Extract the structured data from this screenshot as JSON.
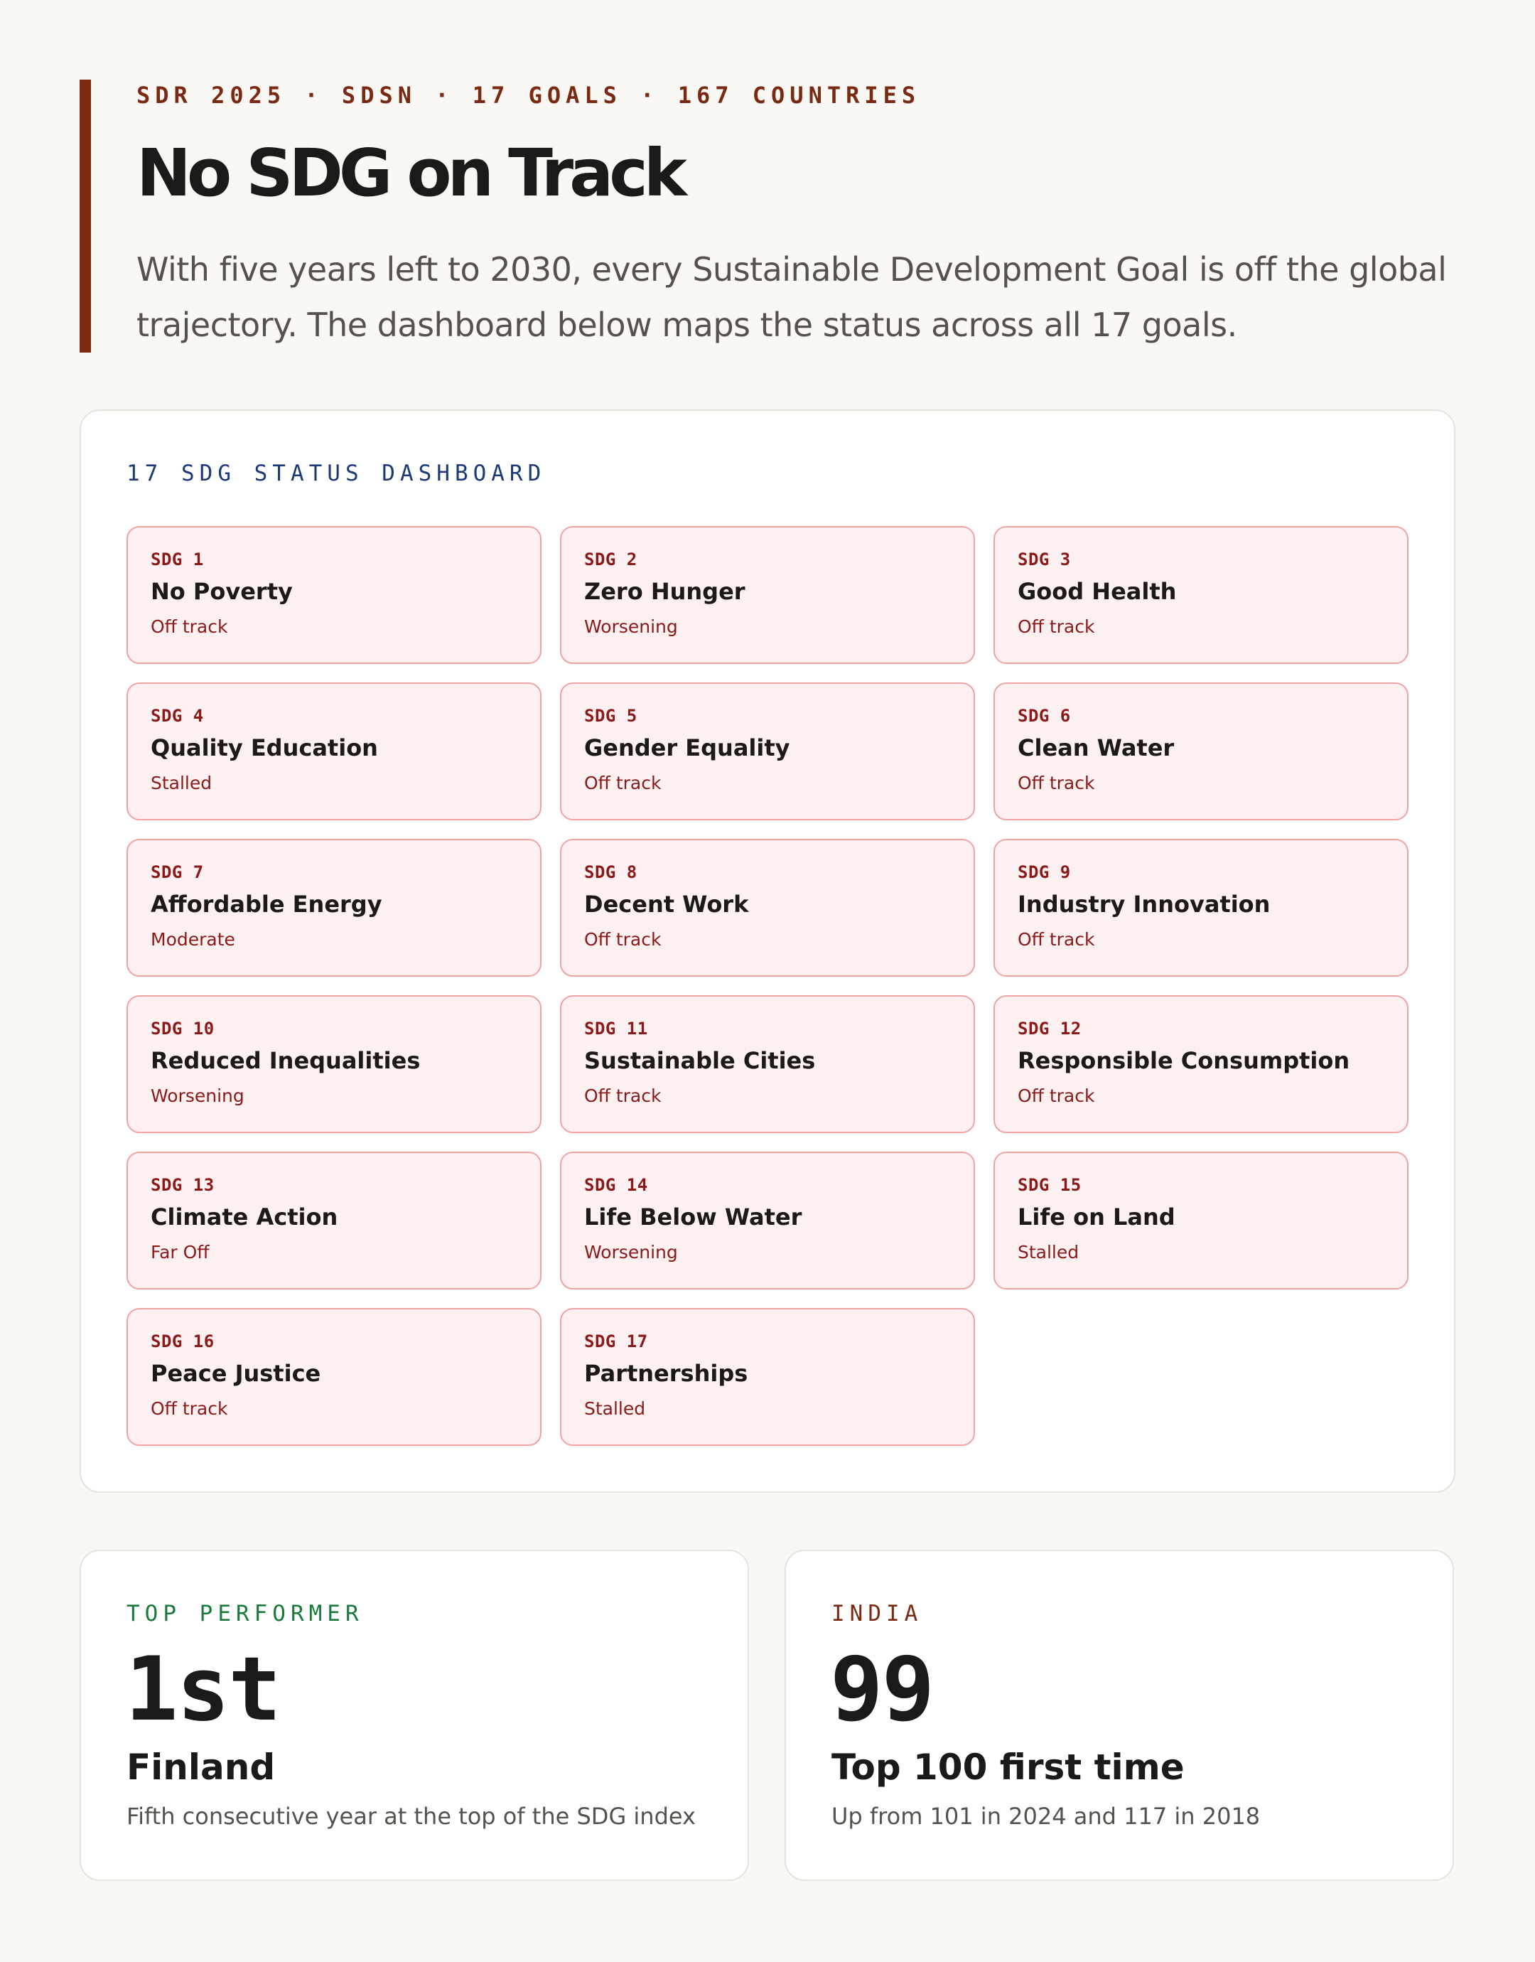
{
  "header": {
    "eyebrow": "SDR 2025 · SDSN · 17 GOALS · 167 COUNTRIES",
    "title": "No SDG on Track",
    "subtitle_line1": "With five years left to 2030, every Sustainable Development Goal is off the global",
    "subtitle_line2": "trajectory. The dashboard below maps the status across all 17 goals."
  },
  "dashboard": {
    "title": "17 SDG STATUS DASHBOARD",
    "goals": [
      {
        "code": "SDG 1",
        "name": "No Poverty",
        "status": "Off track"
      },
      {
        "code": "SDG 2",
        "name": "Zero Hunger",
        "status": "Worsening"
      },
      {
        "code": "SDG 3",
        "name": "Good Health",
        "status": "Off track"
      },
      {
        "code": "SDG 4",
        "name": "Quality Education",
        "status": "Stalled"
      },
      {
        "code": "SDG 5",
        "name": "Gender Equality",
        "status": "Off track"
      },
      {
        "code": "SDG 6",
        "name": "Clean Water",
        "status": "Off track"
      },
      {
        "code": "SDG 7",
        "name": "Affordable Energy",
        "status": "Moderate"
      },
      {
        "code": "SDG 8",
        "name": "Decent Work",
        "status": "Off track"
      },
      {
        "code": "SDG 9",
        "name": "Industry Innovation",
        "status": "Off track"
      },
      {
        "code": "SDG 10",
        "name": "Reduced Inequalities",
        "status": "Worsening"
      },
      {
        "code": "SDG 11",
        "name": "Sustainable Cities",
        "status": "Off track"
      },
      {
        "code": "SDG 12",
        "name": "Responsible Consumption",
        "status": "Off track"
      },
      {
        "code": "SDG 13",
        "name": "Climate Action",
        "status": "Far Off"
      },
      {
        "code": "SDG 14",
        "name": "Life Below Water",
        "status": "Worsening"
      },
      {
        "code": "SDG 15",
        "name": "Life on Land",
        "status": "Stalled"
      },
      {
        "code": "SDG 16",
        "name": "Peace Justice",
        "status": "Off track"
      },
      {
        "code": "SDG 17",
        "name": "Partnerships",
        "status": "Stalled"
      }
    ]
  },
  "top_performer": {
    "label": "TOP PERFORMER",
    "label_color": "#1a7a3a",
    "value": "1st",
    "heading": "Finland",
    "description": "Fifth consecutive year at the top of the SDG index"
  },
  "india": {
    "label": "INDIA",
    "label_color": "#7a2a12",
    "value": "99",
    "heading": "Top 100 first time",
    "description": "Up from 101 in 2024 and 117 in 2018"
  },
  "colors": {
    "accent": "#7a2a12",
    "card_background": "#fdf0f0",
    "card_border": "#efa3a3",
    "status_text": "#8a1a1a",
    "dashboard_title": "#1d3a78"
  }
}
